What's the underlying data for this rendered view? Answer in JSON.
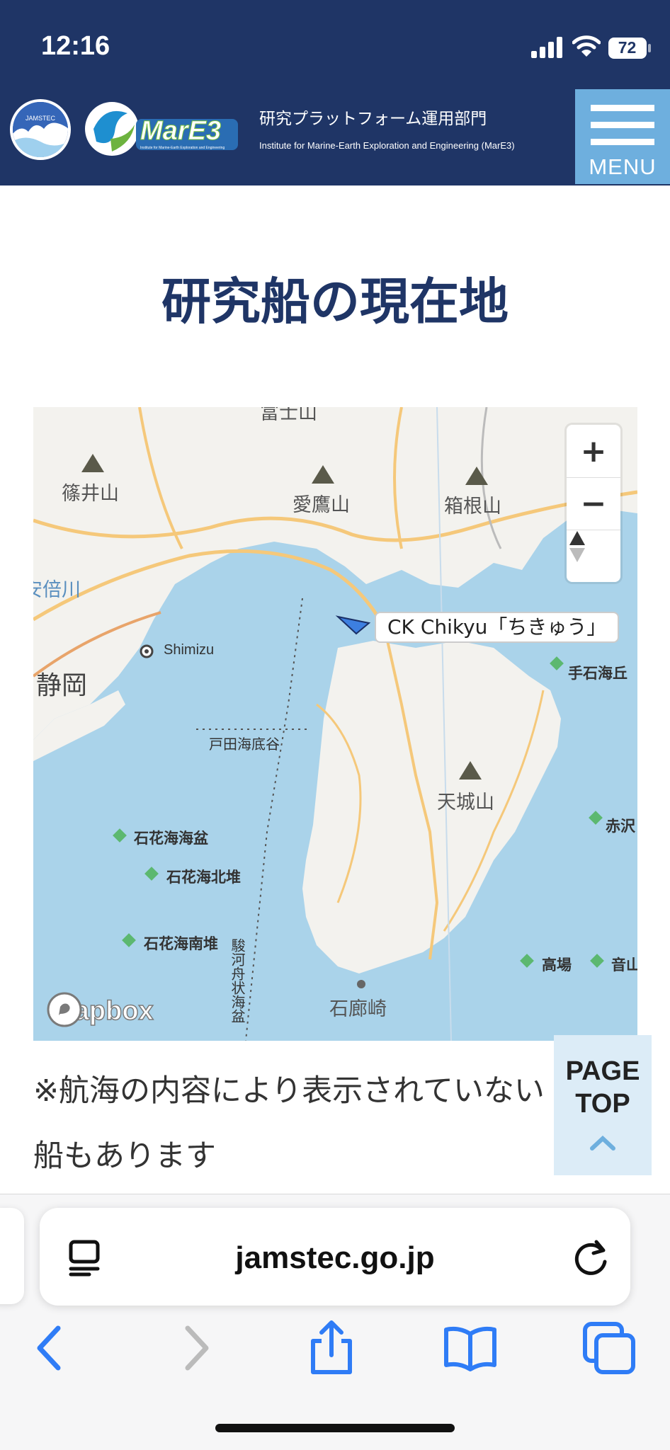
{
  "status_bar": {
    "time": "12:16",
    "battery": "72"
  },
  "header": {
    "jamstec_logo_text": "JAMSTEC",
    "mare3_logo_text": "MarE3",
    "mare3_logo_subtext": "Institute for Marine-Earth Exploration and Engineering",
    "title": "研究プラットフォーム運用部門",
    "subtitle": "Institute for Marine-Earth Exploration and Engineering (MarE3)",
    "menu_label": "MENU"
  },
  "page": {
    "title": "研究船の現在地",
    "note": "※航海の内容により表示されていない船もあります",
    "page_top": "PAGE TOP"
  },
  "map": {
    "ship_label": "CK Chikyu「ちきゅう」",
    "zoom_in": "+",
    "zoom_out": "−",
    "attribution": "mapbox",
    "labels": {
      "shinoi": "篠井山",
      "ashitaka": "愛鷹山",
      "hakone": "箱根山",
      "abe": "安倍川",
      "shizuoka": "静岡",
      "shimizu": "Shimizu",
      "teishi": "手石海丘",
      "heda": "戸田海底谷",
      "amagi": "天城山",
      "akasawa": "赤沢",
      "sekka_basin": "石花海海盆",
      "sekka_north": "石花海北堆",
      "sekka_south": "石花海南堆",
      "suruga_trough": "駿河舟状海盆",
      "takaba": "高場",
      "otoyama": "音山",
      "iro": "石廊崎",
      "fuji_partial": "富士山"
    }
  },
  "browser": {
    "url": "jamstec.go.jp"
  },
  "colors": {
    "navy": "#1f3566",
    "menu_blue": "#6eafde",
    "sea": "#aad3ea",
    "land": "#f3f2ee",
    "road": "#f5c87a"
  }
}
